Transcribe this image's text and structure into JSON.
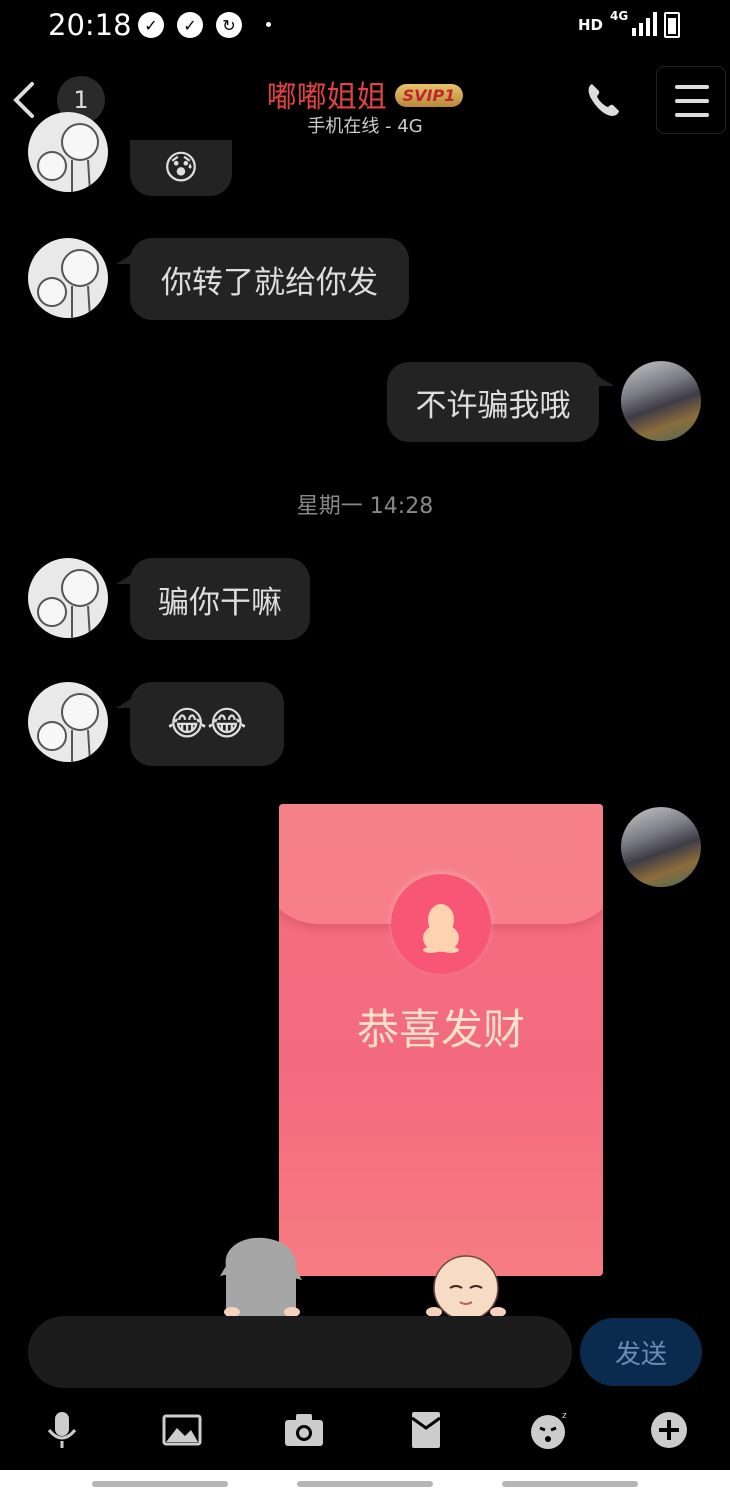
{
  "status_bar": {
    "time": "20:18",
    "hd": "HD",
    "network": "4G",
    "icons": [
      "checklist-icon",
      "checklist-icon",
      "sync-icon"
    ]
  },
  "header": {
    "unread_count": "1",
    "contact_name": "嘟嘟姐姐",
    "vip_badge": "SVIP1",
    "status_line": "手机在线 - 4G",
    "name_color": "#e04343"
  },
  "messages": [
    {
      "side": "left",
      "text": "😰"
    },
    {
      "side": "left",
      "text": "你转了就给你发"
    },
    {
      "side": "right",
      "text": "不许骗我哦"
    },
    {
      "side": "left",
      "text": "骗你干嘛"
    },
    {
      "side": "left",
      "text": "😂😂"
    }
  ],
  "timestamp": "星期一 14:28",
  "red_packet": {
    "text": "恭喜发财",
    "color": "#f36a7f"
  },
  "input": {
    "placeholder": "",
    "send_label": "发送"
  },
  "toolbar": [
    "microphone-icon",
    "image-icon",
    "camera-icon",
    "red-packet-icon",
    "emoji-icon",
    "plus-icon"
  ]
}
